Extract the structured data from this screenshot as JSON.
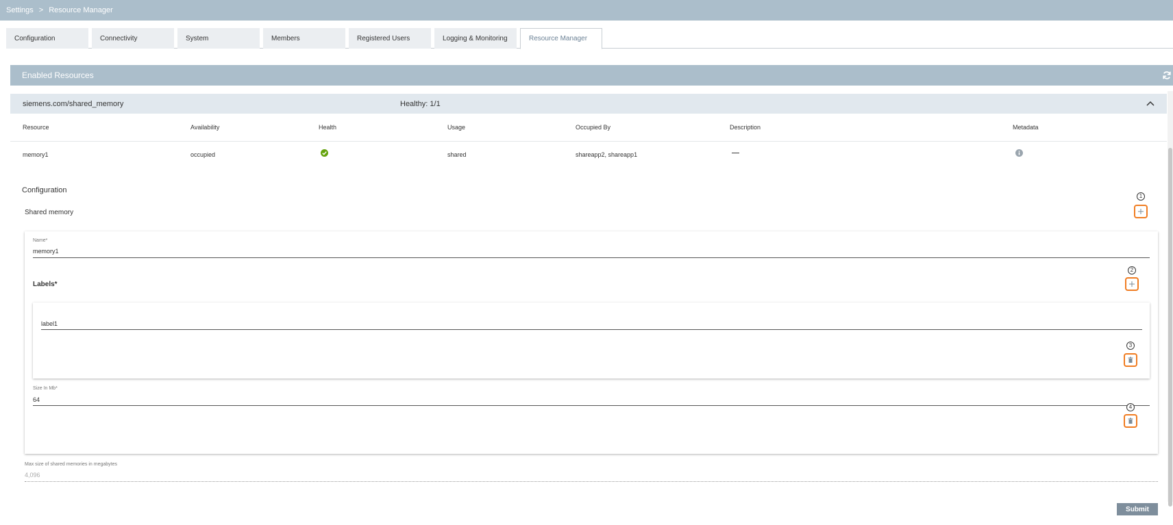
{
  "breadcrumb": {
    "root": "Settings",
    "separator": ">",
    "current": "Resource Manager"
  },
  "tabs": [
    {
      "label": "Configuration",
      "active": false
    },
    {
      "label": "Connectivity",
      "active": false
    },
    {
      "label": "System",
      "active": false
    },
    {
      "label": "Members",
      "active": false
    },
    {
      "label": "Registered Users",
      "active": false
    },
    {
      "label": "Logging & Monitoring",
      "active": false
    },
    {
      "label": "Resource Manager",
      "active": true
    }
  ],
  "panel": {
    "title": "Enabled Resources",
    "refresh_icon": "refresh-icon"
  },
  "group": {
    "name": "siemens.com/shared_memory",
    "health": "Healthy: 1/1",
    "toggle_icon": "chevron-up-icon"
  },
  "table": {
    "columns": [
      "Resource",
      "Availability",
      "Health",
      "Usage",
      "Occupied By",
      "Description",
      "Metadata"
    ],
    "rows": [
      {
        "resource": "memory1",
        "availability": "occupied",
        "health": "ok-icon",
        "usage": "shared",
        "occupied_by": "shareapp2, shareapp1",
        "description": "—",
        "metadata": "info-icon"
      }
    ]
  },
  "config": {
    "title": "Configuration",
    "section_title": "Shared memory",
    "name_label": "Name*",
    "name_value": "memory1",
    "labels_title": "Labels*",
    "label_value": "label1",
    "size_label": "Size In Mb*",
    "size_value": "64",
    "max_label": "Max size of shared memories in megabytes",
    "max_value": "4,096"
  },
  "annotations": [
    "1",
    "2",
    "3",
    "4"
  ],
  "submit_label": "Submit",
  "colors": {
    "header": "#abbecb",
    "accent_orange": "#f07c21",
    "health_ok": "#65a30d",
    "submit": "#7e8e9c"
  }
}
